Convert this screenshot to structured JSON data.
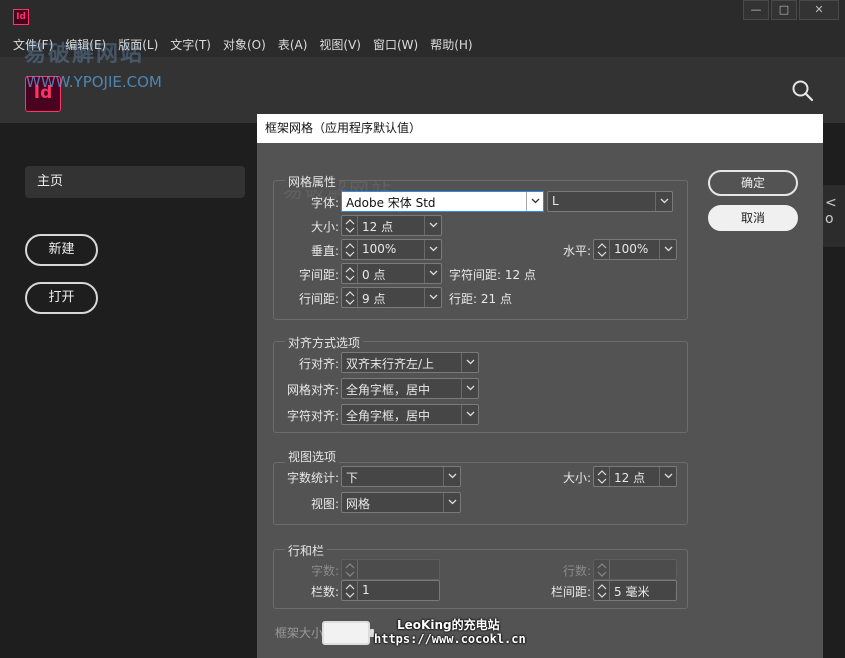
{
  "app": {
    "logo_text": "Id"
  },
  "window": {
    "minimize": "—",
    "maximize": "□",
    "close": "✕"
  },
  "menu": [
    "文件(F)",
    "编辑(E)",
    "版面(L)",
    "文字(T)",
    "对象(O)",
    "表(A)",
    "视图(V)",
    "窗口(W)",
    "帮助(H)"
  ],
  "watermark": {
    "cn": "易破解网站",
    "url": "WWW.YPOJIE.COM"
  },
  "home": {
    "nav_home": "主页",
    "new_button": "新建",
    "open_button": "打开",
    "right_strip": "< o"
  },
  "dialog": {
    "title": "框架网格（应用程序默认值）",
    "ok": "确定",
    "cancel": "取消",
    "grid_props": {
      "title": "网格属性",
      "font_label": "字体:",
      "font_value": "Adobe 宋体 Std",
      "font_style": "L",
      "size_label": "大小:",
      "size_value": "12 点",
      "vertical_label": "垂直:",
      "vertical_value": "100%",
      "horizontal_label": "水平:",
      "horizontal_value": "100%",
      "char_spacing_label": "字间距:",
      "char_spacing_value": "0 点",
      "char_aki_text": "字符间距: 12 点",
      "line_spacing_label": "行间距:",
      "line_spacing_value": "9 点",
      "line_pitch_text": "行距: 21 点"
    },
    "alignment": {
      "title": "对齐方式选项",
      "line_align_label": "行对齐:",
      "line_align_value": "双齐末行齐左/上",
      "grid_align_label": "网格对齐:",
      "grid_align_value": "全角字框，居中",
      "char_align_label": "字符对齐:",
      "char_align_value": "全角字框，居中"
    },
    "view": {
      "title": "视图选项",
      "count_label": "字数统计:",
      "count_value": "下",
      "size_label": "大小:",
      "size_value": "12 点",
      "view_label": "视图:",
      "view_value": "网格"
    },
    "rows_cols": {
      "title": "行和栏",
      "chars_label": "字数:",
      "lines_label": "行数:",
      "cols_label": "栏数:",
      "cols_value": "1",
      "gutter_label": "栏间距:",
      "gutter_value": "5 毫米"
    },
    "frame_size_label": "框架大小"
  },
  "overlay": {
    "line1": "LeoKing的充电站",
    "line2": "https://www.cocokl.cn"
  }
}
